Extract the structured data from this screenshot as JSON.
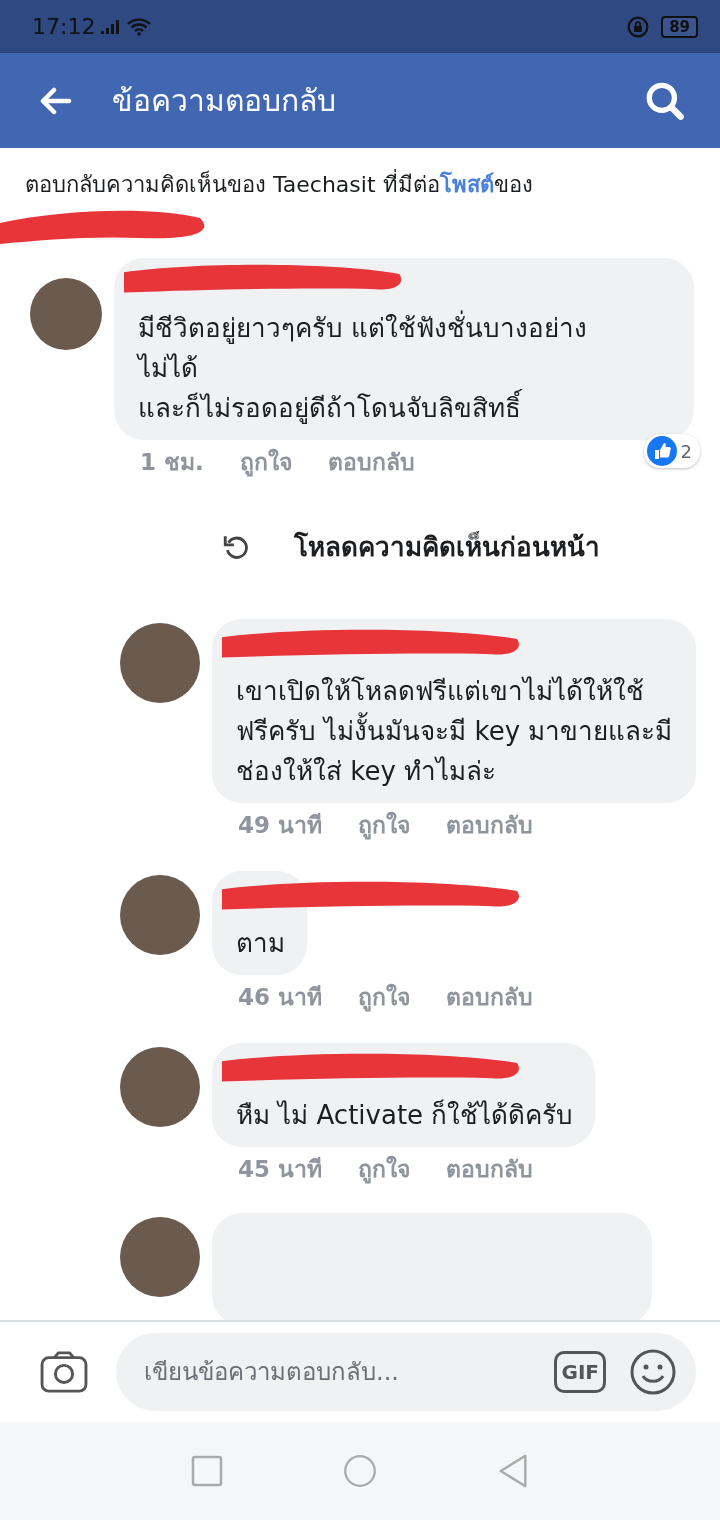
{
  "status_bar": {
    "time": "17:12",
    "battery": "89"
  },
  "header": {
    "title": "ข้อความตอบกลับ"
  },
  "context": {
    "before": "ตอบกลับความคิดเห็นของ Taechasit ที่มีต่อ",
    "link": "โพสต์",
    "after": "ของ"
  },
  "main_comment": {
    "text": "มีชีวิตอยู่ยาวๆครับ แต่ใช้ฟังชั่นบางอย่าง\nไม่ได้\nและก็ไม่รอดอยู่ดีถ้าโดนจับลิขสิทธิ์",
    "time": "1 ชม.",
    "like": "ถูกใจ",
    "reply": "ตอบกลับ",
    "reactions": "2"
  },
  "load_previous": "โหลดความคิดเห็นก่อนหน้า",
  "replies": [
    {
      "text": "เขาเปิดให้โหลดฟรีแต่เขาไม่ได้ให้ใช้ฟรีครับ ไม่งั้นมันจะมี key มาขายและมีช่องให้ใส่ key ทำไมล่ะ",
      "time": "49 นาที",
      "like": "ถูกใจ",
      "reply": "ตอบกลับ"
    },
    {
      "text": "ตาม",
      "time": "46 นาที",
      "like": "ถูกใจ",
      "reply": "ตอบกลับ"
    },
    {
      "text": "หืม ไม่ Activate ก็ใช้ได้ดิครับ",
      "time": "45 นาที",
      "like": "ถูกใจ",
      "reply": "ตอบกลับ"
    }
  ],
  "composer": {
    "placeholder": "เขียนข้อความตอบกลับ...",
    "gif": "GIF"
  }
}
